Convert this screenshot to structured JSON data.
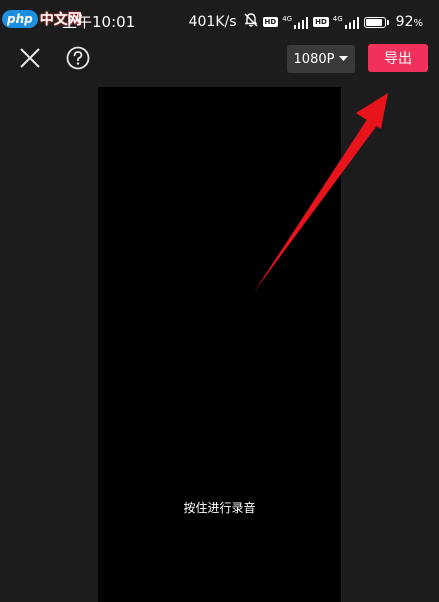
{
  "watermark": {
    "badge": "php",
    "text": "中文网"
  },
  "status_bar": {
    "time": "上午10:01",
    "net_speed": "401K/s",
    "hd_label": "HD",
    "network_label": "4G",
    "battery_percent": "92",
    "battery_symbol": "%",
    "battery_level": 0.92
  },
  "toolbar": {
    "close_icon": "close-icon",
    "help_icon": "help-icon",
    "resolution_label": "1080P",
    "export_label": "导出"
  },
  "preview": {
    "hint": "按住进行录音"
  },
  "colors": {
    "background": "#1c1c1c",
    "preview": "#000000",
    "export_button": "#f1305b",
    "resolution_button": "#3a3a3a",
    "arrow": "#e8141c"
  }
}
